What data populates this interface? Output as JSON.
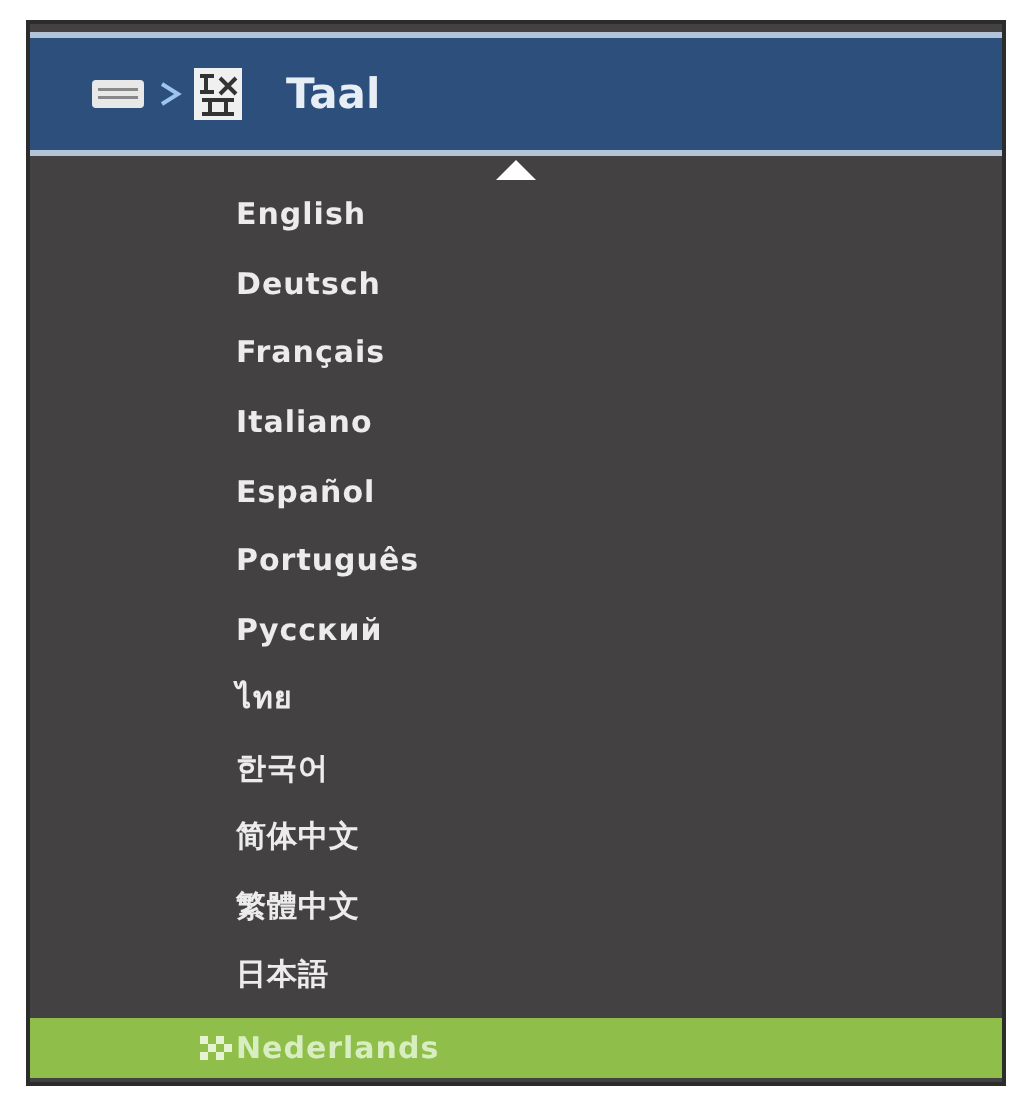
{
  "header": {
    "title": "Taal"
  },
  "languages": [
    {
      "label": "English",
      "selected": false
    },
    {
      "label": "Deutsch",
      "selected": false
    },
    {
      "label": "Français",
      "selected": false
    },
    {
      "label": "Italiano",
      "selected": false
    },
    {
      "label": "Español",
      "selected": false
    },
    {
      "label": "Português",
      "selected": false
    },
    {
      "label": "Русский",
      "selected": false
    },
    {
      "label": "ไทย",
      "selected": false
    },
    {
      "label": "한국어",
      "selected": false
    },
    {
      "label": "简体中文",
      "selected": false
    },
    {
      "label": "繁體中文",
      "selected": false
    },
    {
      "label": "日本語",
      "selected": false
    },
    {
      "label": "Nederlands",
      "selected": true
    }
  ]
}
